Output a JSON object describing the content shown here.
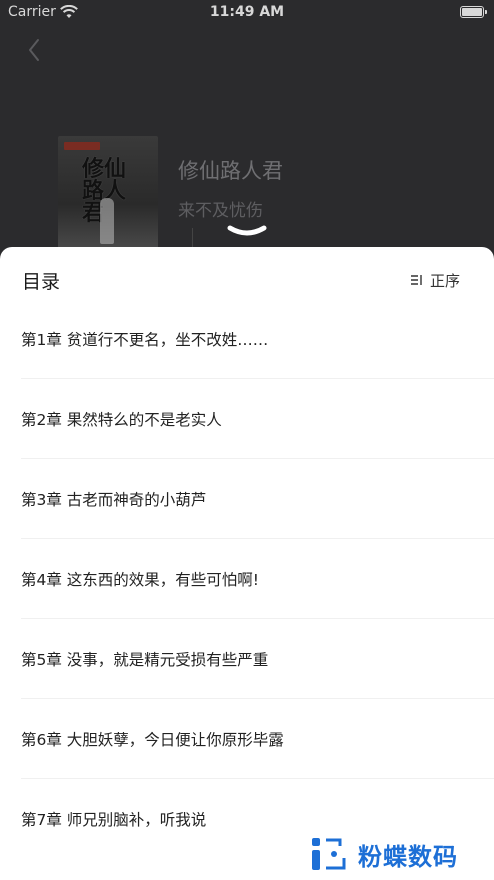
{
  "status_bar": {
    "carrier": "Carrier",
    "time": "11:49 AM"
  },
  "book": {
    "title": "修仙路人君",
    "author": "来不及忧伤",
    "cover_text": "修仙路人君"
  },
  "toc": {
    "title": "目录",
    "sort_label": "正序",
    "chapters": [
      "第1章 贫道行不更名，坐不改姓……",
      "第2章 果然特么的不是老实人",
      "第3章 古老而神奇的小葫芦",
      "第4章 这东西的效果，有些可怕啊!",
      "第5章 没事，就是精元受损有些严重",
      "第6章 大胆妖孽，今日便让你原形毕露",
      "第7章 师兄别脑补，听我说"
    ]
  },
  "watermark": {
    "text": "粉蝶数码",
    "color": "#1d6fd6"
  },
  "colors": {
    "overlay_bg": "#2b2b2d",
    "sheet_bg": "#ffffff"
  }
}
